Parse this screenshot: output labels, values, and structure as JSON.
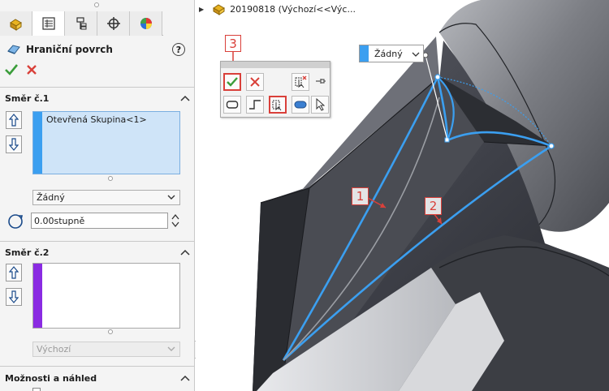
{
  "property_manager": {
    "feature_title": "Hraniční povrch",
    "help_symbol": "?",
    "tabs": [
      "feature-manager-icon",
      "property-manager-icon",
      "configuration-manager-icon",
      "dimxpert-icon",
      "display-manager-icon"
    ],
    "direction1": {
      "header": "Směr č.1",
      "list_item": "Otevřená Skupina<1>",
      "list_color": "#3b9ff0",
      "tangency": "Žádný",
      "angle_value": "0.00stupně"
    },
    "direction2": {
      "header": "Směr č.2",
      "list_color": "#8a2be2",
      "tangency": "Výchozí"
    },
    "options_header": "Možnosti a náhled"
  },
  "viewport": {
    "tree_node": "20190818  (Výchozí<<Výc...",
    "tag_combo": "Žádný",
    "callouts": [
      "1",
      "2",
      "3"
    ]
  },
  "colors": {
    "accent_red": "#d9403a",
    "ok_green": "#3a9d3a",
    "curve_blue": "#3b9ff0"
  }
}
